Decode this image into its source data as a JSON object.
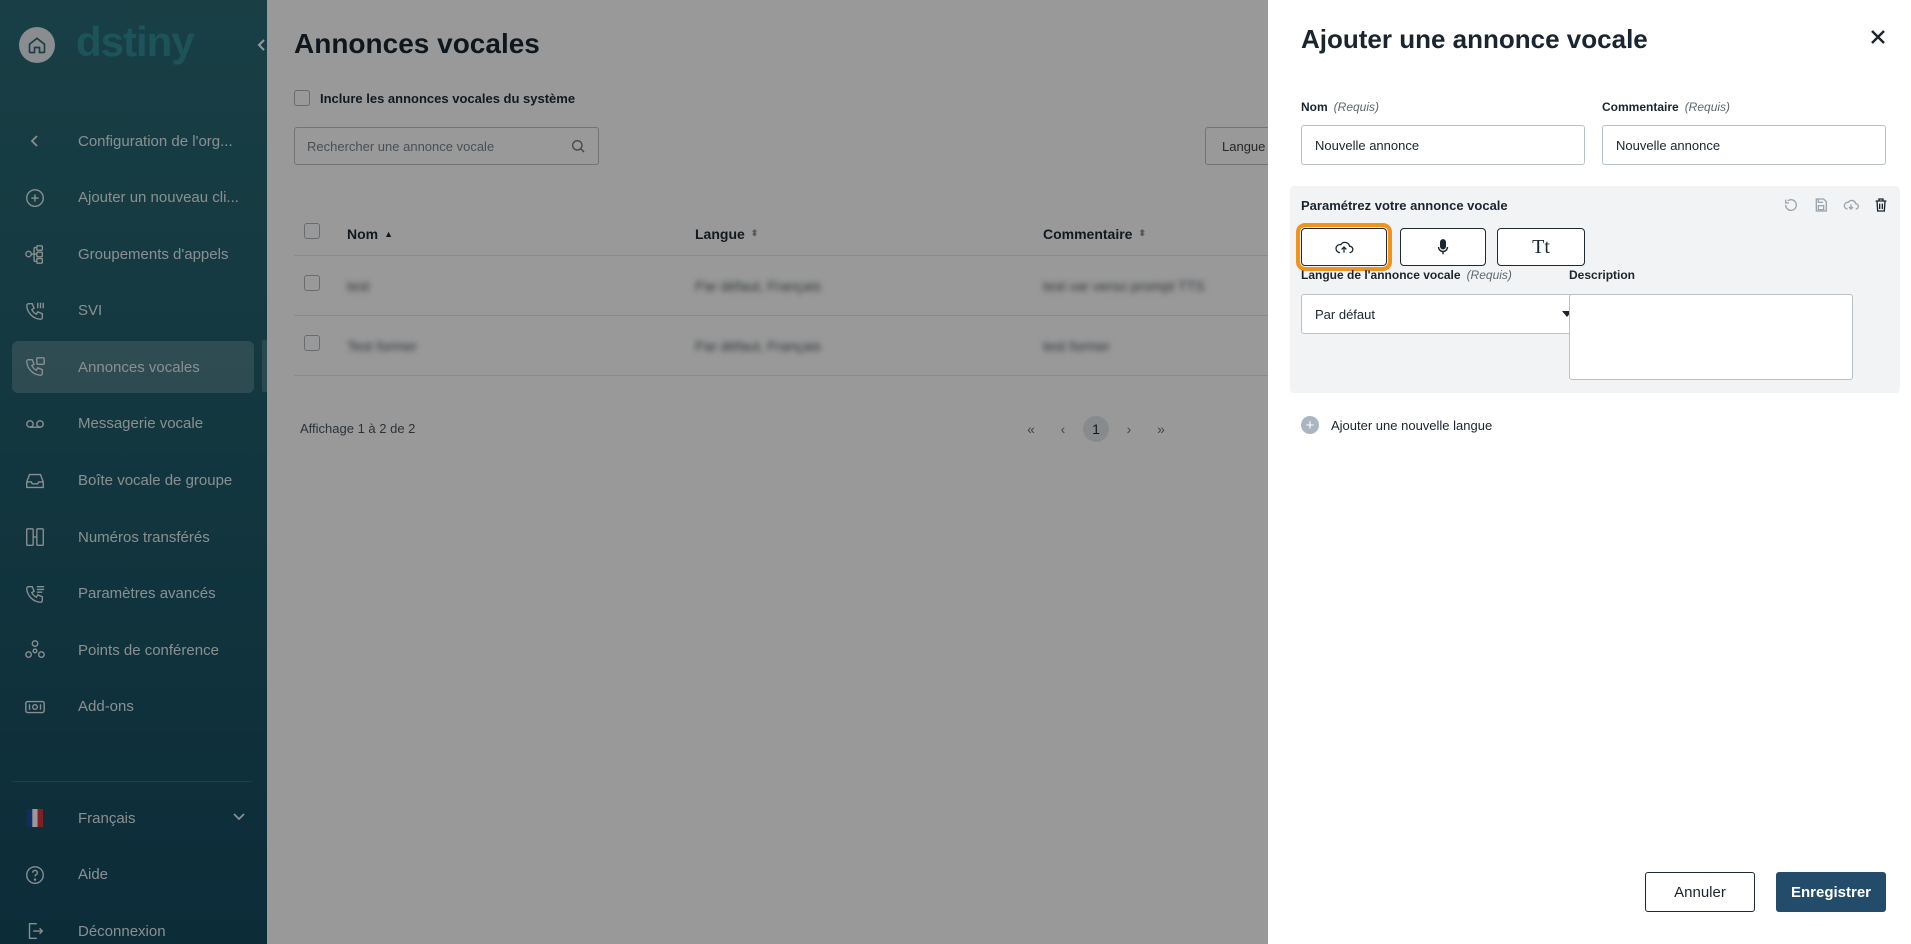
{
  "brand": {
    "logo_text": "dstiny",
    "accent": "#2f8c97"
  },
  "sidebar": {
    "items": [
      {
        "label": "Configuration de l'org...",
        "icon": "chevron-left-icon"
      },
      {
        "label": "Ajouter un nouveau cli...",
        "icon": "plus-circle-icon"
      },
      {
        "label": "Groupements d'appels",
        "icon": "call-group-icon"
      },
      {
        "label": "SVI",
        "icon": "ivr-phone-icon"
      },
      {
        "label": "Annonces vocales",
        "icon": "announcement-icon",
        "active": true
      },
      {
        "label": "Messagerie vocale",
        "icon": "voicemail-icon"
      },
      {
        "label": "Boîte vocale de groupe",
        "icon": "inbox-icon"
      },
      {
        "label": "Numéros transférés",
        "icon": "forwarded-numbers-icon"
      },
      {
        "label": "Paramètres avancés",
        "icon": "advanced-settings-icon"
      },
      {
        "label": "Points de conférence",
        "icon": "conference-icon"
      },
      {
        "label": "Add-ons",
        "icon": "addons-icon"
      }
    ],
    "bottom": [
      {
        "label": "Français",
        "icon": "flag-fr-icon"
      },
      {
        "label": "Aide",
        "icon": "help-icon"
      },
      {
        "label": "Déconnexion",
        "icon": "logout-icon"
      }
    ]
  },
  "main": {
    "title": "Annonces vocales",
    "include_system_label": "Inclure les annonces vocales du système",
    "search_placeholder": "Rechercher une annonce vocale",
    "language_filter": "Langue",
    "columns": [
      "Nom",
      "Langue",
      "Commentaire"
    ],
    "rows": [
      [
        "test",
        "Par défaut, Français",
        "test var verso prompt TTS"
      ],
      [
        "Test former",
        "Par défaut, Français",
        "test former"
      ]
    ],
    "pagination_info": "Affichage 1 à 2 de 2",
    "current_page": "1"
  },
  "drawer": {
    "title": "Ajouter une annonce vocale",
    "name_label": "Nom",
    "name_required": "(Requis)",
    "name_value": "Nouvelle annonce",
    "comment_label": "Commentaire",
    "comment_required": "(Requis)",
    "comment_value": "Nouvelle annonce",
    "config_title": "Paramétrez votre annonce vocale",
    "lang_label": "Langue de l'annonce vocale",
    "lang_required": "(Requis)",
    "lang_value": "Par défaut",
    "description_label": "Description",
    "add_language": "Ajouter une nouvelle langue",
    "cancel": "Annuler",
    "save": "Enregistrer",
    "highlight_color": "#f0941c"
  }
}
